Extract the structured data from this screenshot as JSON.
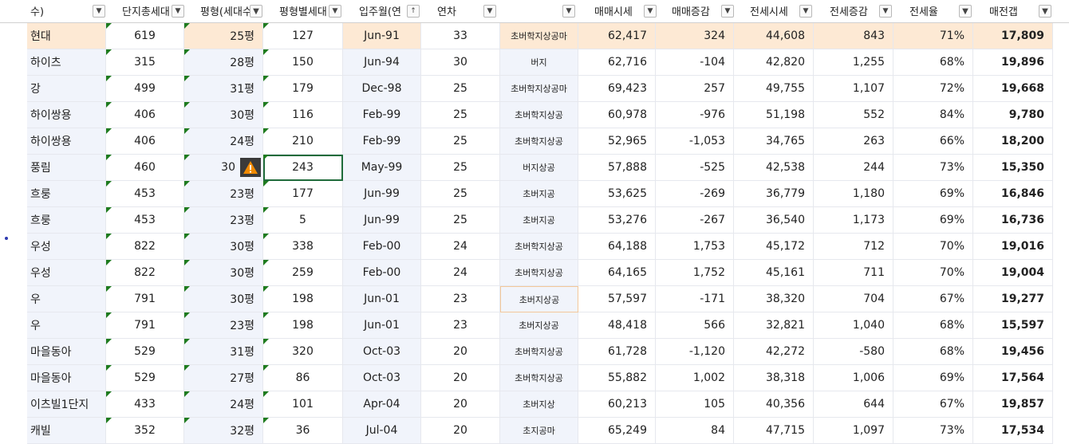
{
  "headers": [
    "수)",
    "단지총세대",
    "평형(세대수",
    "평형별세대",
    "입주월(연",
    "연차",
    "",
    "매매시세",
    "매매증감",
    "전세시세",
    "전세증감",
    "전세율",
    "매전갭"
  ],
  "filter_states": [
    "arrow",
    "arrow",
    "filtered",
    "arrow",
    "sorted",
    "arrow",
    "arrow",
    "arrow",
    "arrow",
    "arrow",
    "arrow",
    "filtered",
    "filtered"
  ],
  "rows": [
    {
      "name": "현대",
      "total": "619",
      "size": "25평",
      "units": "127",
      "date": "Jun-91",
      "age": "33",
      "facilities": "초버학지상공마",
      "price": "62,417",
      "price_chg": "324",
      "jeonse": "44,608",
      "jeonse_chg": "843",
      "ratio": "71%",
      "gap": "17,809"
    },
    {
      "name": "하이츠",
      "total": "315",
      "size": "28평",
      "units": "150",
      "date": "Jun-94",
      "age": "30",
      "facilities": "버지",
      "price": "62,716",
      "price_chg": "-104",
      "jeonse": "42,820",
      "jeonse_chg": "1,255",
      "ratio": "68%",
      "gap": "19,896"
    },
    {
      "name": "강",
      "total": "499",
      "size": "31평",
      "units": "179",
      "date": "Dec-98",
      "age": "25",
      "facilities": "초버학지상공마",
      "price": "69,423",
      "price_chg": "257",
      "jeonse": "49,755",
      "jeonse_chg": "1,107",
      "ratio": "72%",
      "gap": "19,668"
    },
    {
      "name": "하이쌍용",
      "total": "406",
      "size": "30평",
      "units": "116",
      "date": "Feb-99",
      "age": "25",
      "facilities": "초버학지상공",
      "price": "60,978",
      "price_chg": "-976",
      "jeonse": "51,198",
      "jeonse_chg": "552",
      "ratio": "84%",
      "gap": "9,780"
    },
    {
      "name": "하이쌍용",
      "total": "406",
      "size": "24평",
      "units": "210",
      "date": "Feb-99",
      "age": "25",
      "facilities": "초버학지상공",
      "price": "52,965",
      "price_chg": "-1,053",
      "jeonse": "34,765",
      "jeonse_chg": "263",
      "ratio": "66%",
      "gap": "18,200"
    },
    {
      "name": "풍림",
      "total": "460",
      "size": "30",
      "units": "243",
      "date": "May-99",
      "age": "25",
      "facilities": "버지상공",
      "price": "57,888",
      "price_chg": "-525",
      "jeonse": "42,538",
      "jeonse_chg": "244",
      "ratio": "73%",
      "gap": "15,350"
    },
    {
      "name": "흐룽",
      "total": "453",
      "size": "23평",
      "units": "177",
      "date": "Jun-99",
      "age": "25",
      "facilities": "초버지공",
      "price": "53,625",
      "price_chg": "-269",
      "jeonse": "36,779",
      "jeonse_chg": "1,180",
      "ratio": "69%",
      "gap": "16,846"
    },
    {
      "name": "흐룽",
      "total": "453",
      "size": "23평",
      "units": "5",
      "date": "Jun-99",
      "age": "25",
      "facilities": "초버지공",
      "price": "53,276",
      "price_chg": "-267",
      "jeonse": "36,540",
      "jeonse_chg": "1,173",
      "ratio": "69%",
      "gap": "16,736"
    },
    {
      "name": "우성",
      "total": "822",
      "size": "30평",
      "units": "338",
      "date": "Feb-00",
      "age": "24",
      "facilities": "초버학지상공",
      "price": "64,188",
      "price_chg": "1,753",
      "jeonse": "45,172",
      "jeonse_chg": "712",
      "ratio": "70%",
      "gap": "19,016"
    },
    {
      "name": "우성",
      "total": "822",
      "size": "30평",
      "units": "259",
      "date": "Feb-00",
      "age": "24",
      "facilities": "초버학지상공",
      "price": "64,165",
      "price_chg": "1,752",
      "jeonse": "45,161",
      "jeonse_chg": "711",
      "ratio": "70%",
      "gap": "19,004"
    },
    {
      "name": "우",
      "total": "791",
      "size": "30평",
      "units": "198",
      "date": "Jun-01",
      "age": "23",
      "facilities": "초버지상공",
      "price": "57,597",
      "price_chg": "-171",
      "jeonse": "38,320",
      "jeonse_chg": "704",
      "ratio": "67%",
      "gap": "19,277"
    },
    {
      "name": "우",
      "total": "791",
      "size": "23평",
      "units": "198",
      "date": "Jun-01",
      "age": "23",
      "facilities": "초버지상공",
      "price": "48,418",
      "price_chg": "566",
      "jeonse": "32,821",
      "jeonse_chg": "1,040",
      "ratio": "68%",
      "gap": "15,597"
    },
    {
      "name": "마을동아",
      "total": "529",
      "size": "31평",
      "units": "320",
      "date": "Oct-03",
      "age": "20",
      "facilities": "초버학지상공",
      "price": "61,728",
      "price_chg": "-1,120",
      "jeonse": "42,272",
      "jeonse_chg": "-580",
      "ratio": "68%",
      "gap": "19,456"
    },
    {
      "name": "마을동아",
      "total": "529",
      "size": "27평",
      "units": "86",
      "date": "Oct-03",
      "age": "20",
      "facilities": "초버학지상공",
      "price": "55,882",
      "price_chg": "1,002",
      "jeonse": "38,318",
      "jeonse_chg": "1,006",
      "ratio": "69%",
      "gap": "17,564"
    },
    {
      "name": "이츠빌1단지",
      "total": "433",
      "size": "24평",
      "units": "101",
      "date": "Apr-04",
      "age": "20",
      "facilities": "초버지상",
      "price": "60,213",
      "price_chg": "105",
      "jeonse": "40,356",
      "jeonse_chg": "644",
      "ratio": "67%",
      "gap": "19,857"
    },
    {
      "name": "캐빌",
      "total": "352",
      "size": "32평",
      "units": "36",
      "date": "Jul-04",
      "age": "20",
      "facilities": "초지공마",
      "price": "65,249",
      "price_chg": "84",
      "jeonse": "47,715",
      "jeonse_chg": "1,097",
      "ratio": "73%",
      "gap": "17,534"
    }
  ],
  "colors": {
    "highlight": "#fde9d4",
    "alt": "#f1f4fb",
    "grid": "#e6e8ee",
    "triangle": "#1e7b1e",
    "selection": "#1f6b3a",
    "warning": "#f08a00"
  },
  "icons": {
    "warning": "warning-icon",
    "filter": "filter-funnel-icon",
    "dropdown": "dropdown-arrow-icon",
    "sort": "sort-ascending-icon"
  }
}
